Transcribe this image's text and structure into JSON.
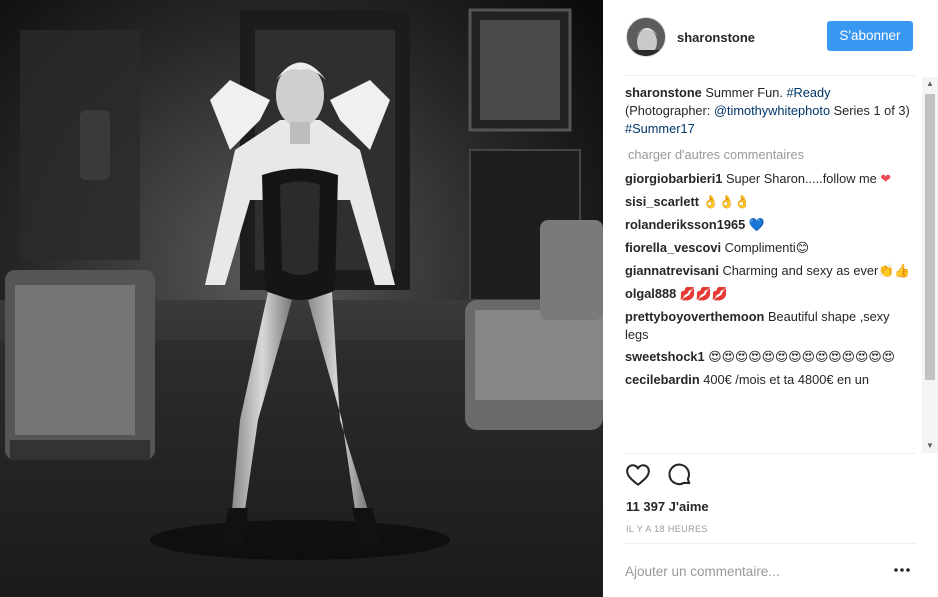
{
  "post": {
    "username": "sharonstone",
    "follow_label": "S'abonner",
    "caption": {
      "text": "Summer Fun. ",
      "tag1": "#Ready",
      "text2": " (Photographer: ",
      "mention": "@timothywhitephoto",
      "text3": " Series 1 of 3) ",
      "tag2": "#Summer17"
    },
    "load_more": "charger d'autres commentaires",
    "comments": [
      {
        "user": "giorgiobarbieri1",
        "text": "Super Sharon.....follow me ",
        "emoji": "❤"
      },
      {
        "user": "sisi_scarlett",
        "text": "",
        "emoji": "👌👌👌"
      },
      {
        "user": "rolanderiksson1965",
        "text": "",
        "emoji": "💙"
      },
      {
        "user": "fiorella_vescovi",
        "text": "Complimenti",
        "emoji": "😊"
      },
      {
        "user": "giannatrevisani",
        "text": "Charming and sexy as ever",
        "emoji": "👏👍"
      },
      {
        "user": "olgal888",
        "text": "",
        "emoji": "💋💋💋"
      },
      {
        "user": "prettyboyoverthemoon",
        "text": "Beautiful shape ,sexy legs",
        "emoji": ""
      },
      {
        "user": "sweetshock1",
        "text": "",
        "emoji": "😍😍😍😍😍😍😍😍😍😍😍😍😍😍"
      },
      {
        "user": "cecilebardin",
        "text": "400€ /mois et ta 4800€ en un",
        "emoji": ""
      }
    ],
    "likes": "11 397 J'aime",
    "timestamp": "IL Y A 18 HEURES",
    "add_comment_placeholder": "Ajouter un commentaire...",
    "colors": {
      "accent": "#3897f0",
      "link": "#003569",
      "heart": "#ed4956"
    }
  }
}
